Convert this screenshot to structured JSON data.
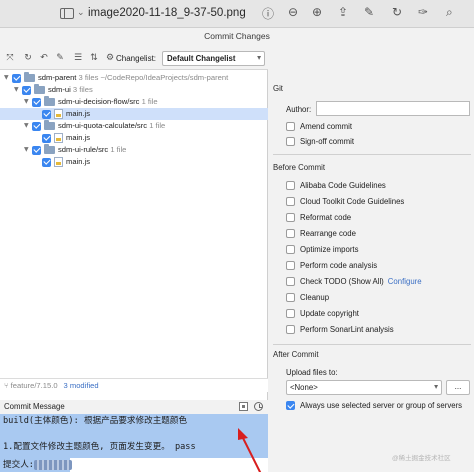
{
  "window": {
    "file_title": "image2020-11-18_9-37-50.png",
    "dialog_title": "Commit Changes"
  },
  "toolbar": {
    "changelist_label": "Changelist:",
    "changelist_value": "Default Changelist"
  },
  "tree": [
    {
      "label": "sdm-parent",
      "meta": "3 files ~/CodeRepo/IdeaProjects/sdm-parent",
      "kind": "folder"
    },
    {
      "label": "sdm-ui",
      "meta": "3 files",
      "kind": "folder"
    },
    {
      "label": "sdm-ui-decision-flow/src",
      "meta": "1 file",
      "kind": "folder"
    },
    {
      "label": "main.js",
      "meta": "",
      "kind": "file"
    },
    {
      "label": "sdm-ui-quota-calculate/src",
      "meta": "1 file",
      "kind": "folder"
    },
    {
      "label": "main.js",
      "meta": "",
      "kind": "file"
    },
    {
      "label": "sdm-ui-rule/src",
      "meta": "1 file",
      "kind": "folder"
    },
    {
      "label": "main.js",
      "meta": "",
      "kind": "file"
    }
  ],
  "status": {
    "branch": "feature/7.15.0",
    "modified": "3 modified"
  },
  "commit_message": {
    "header": "Commit Message",
    "line1": "build(主体颜色): 根据产品要求修改主题颜色",
    "line2": "1.配置文件修改主题颜色, 页面发生变更。 pass",
    "line3": "提交人:"
  },
  "git": {
    "section": "Git",
    "author_label": "Author:",
    "author_value": "",
    "amend": "Amend commit",
    "signoff": "Sign-off commit"
  },
  "before_commit": {
    "section": "Before Commit",
    "options": [
      {
        "label": "Alibaba Code Guidelines",
        "checked": false
      },
      {
        "label": "Cloud Toolkit Code Guidelines",
        "checked": false
      },
      {
        "label": "Reformat code",
        "checked": false
      },
      {
        "label": "Rearrange code",
        "checked": false
      },
      {
        "label": "Optimize imports",
        "checked": false
      },
      {
        "label": "Perform code analysis",
        "checked": false
      },
      {
        "label": "Check TODO (Show All)",
        "checked": false,
        "link": "Configure"
      },
      {
        "label": "Cleanup",
        "checked": false
      },
      {
        "label": "Update copyright",
        "checked": false
      },
      {
        "label": "Perform SonarLint analysis",
        "checked": false
      }
    ]
  },
  "after_commit": {
    "section": "After Commit",
    "upload_label": "Upload files to:",
    "server_value": "<None>",
    "more_label": "...",
    "always_use": "Always use selected server or group of servers"
  },
  "watermark": "@稀土掘金技术社区",
  "colors": {
    "accent": "#3a86f0",
    "selection": "#cfe0fa",
    "commit_highlight": "#a9c9f1",
    "arrow": "#d81e1e"
  }
}
